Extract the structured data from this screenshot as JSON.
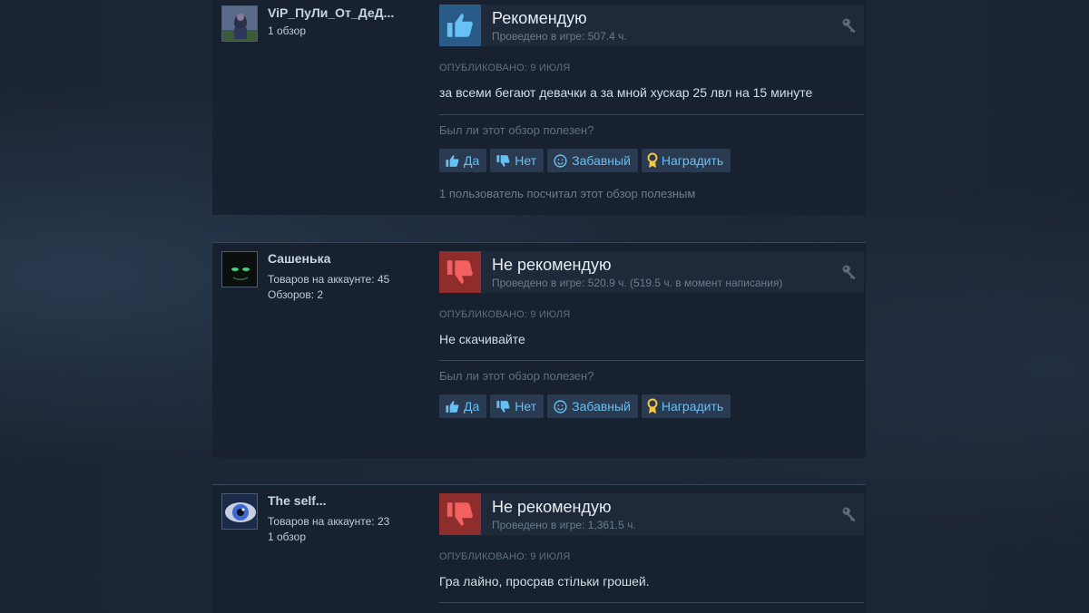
{
  "common": {
    "posted_label": "ОПУБЛИКОВАНО: 9 ИЮЛЯ",
    "helpful_question": "Был ли этот обзор полезен?",
    "btn_yes": "Да",
    "btn_no": "Нет",
    "btn_funny": "Забавный",
    "btn_award": "Наградить"
  },
  "colors": {
    "recommend_bg": "#2a5a86",
    "not_recommend_bg": "#8f2d2d",
    "button_text": "#66c0f4"
  },
  "reviews": [
    {
      "author": "ViP_ПуЛи_От_ДеД...",
      "author_line1": "1 обзор",
      "author_line2": "",
      "verdict": "Рекомендую",
      "verdict_icon": "thumbs-up-icon",
      "hours": "Проведено в игре: 507.4 ч.",
      "text": "за всеми бегают девачки а за мной хускар 25 лвл на 15 минуте",
      "found_helpful": "1 пользователь посчитал этот обзор полезным"
    },
    {
      "author": "Сашенька",
      "author_line1": "Товаров на аккаунте: 45",
      "author_line2": "Обзоров: 2",
      "verdict": "Не рекомендую",
      "verdict_icon": "thumbs-down-icon",
      "hours": "Проведено в игре: 520.9 ч. (519.5 ч. в момент написания)",
      "text": "Не скачивайте",
      "found_helpful": ""
    },
    {
      "author": "The self...",
      "author_line1": "Товаров на аккаунте: 23",
      "author_line2": "1 обзор",
      "verdict": "Не рекомендую",
      "verdict_icon": "thumbs-down-icon",
      "hours": "Проведено в игре: 1,361.5 ч.",
      "text": "Гра лайно, просрав стільки грошей.",
      "found_helpful": ""
    }
  ]
}
